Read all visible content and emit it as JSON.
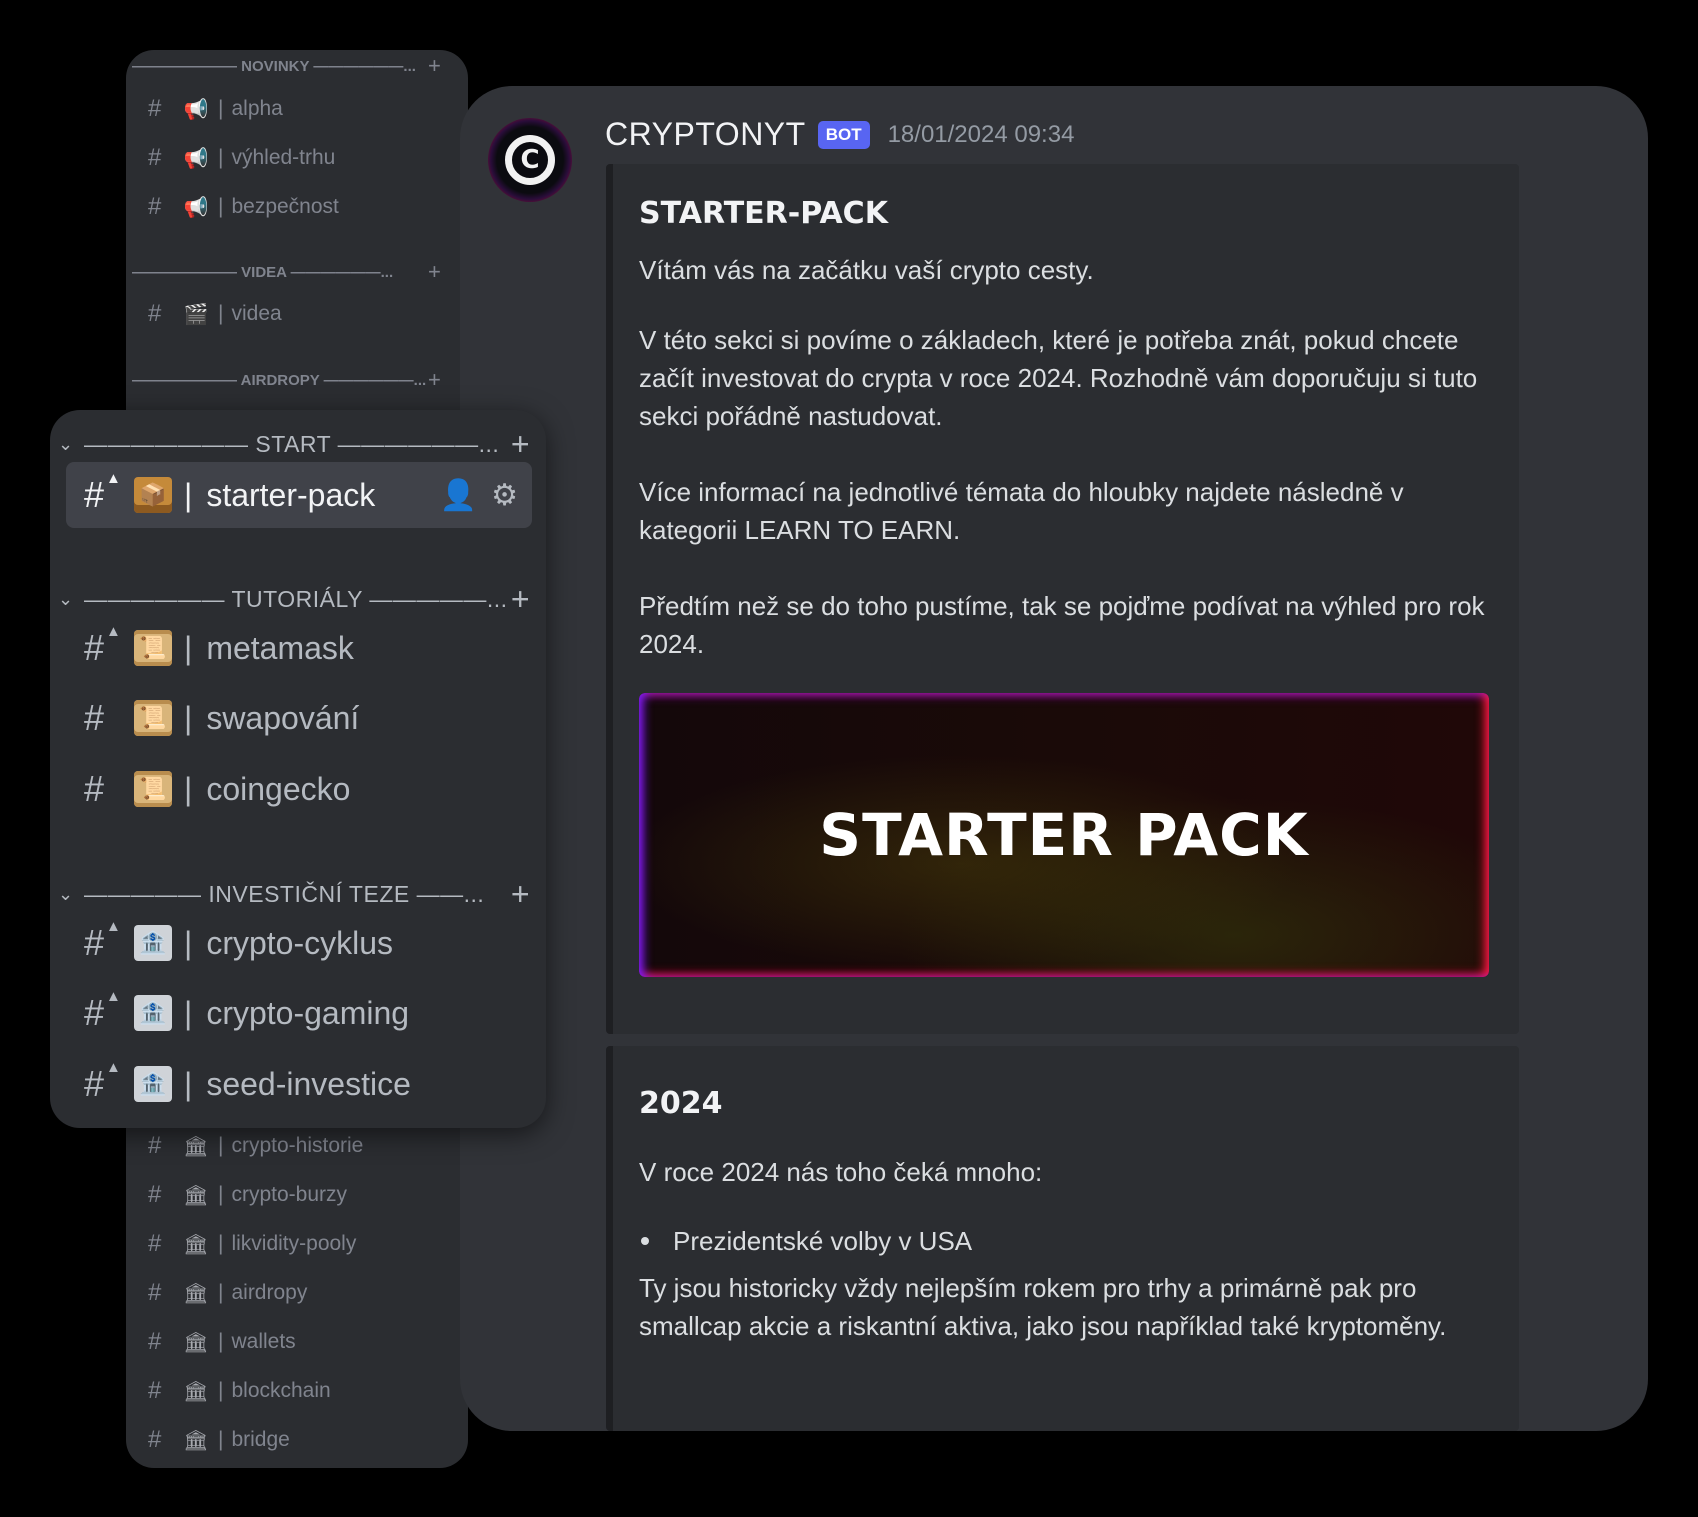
{
  "background_sidebar": {
    "categories": [
      {
        "label": "——————— NOVINKY ——————...",
        "plus": "+"
      },
      {
        "label": "——————— VIDEA ——————...",
        "plus": "+"
      },
      {
        "label": "——————— AIRDROPY ——————...",
        "plus": "+"
      }
    ],
    "channels": [
      {
        "hash": "#",
        "icon": "📢",
        "sep": "|",
        "name": "alpha"
      },
      {
        "hash": "#",
        "icon": "📢",
        "sep": "|",
        "name": "výhled-trhu"
      },
      {
        "hash": "#",
        "icon": "📢",
        "sep": "|",
        "name": "bezpečnost"
      },
      {
        "hash": "#",
        "icon": "🎬",
        "sep": "|",
        "name": "videa"
      },
      {
        "hash": "#",
        "icon": "🏛",
        "sep": "|",
        "name": "crypto-historie"
      },
      {
        "hash": "#",
        "icon": "🏛",
        "sep": "|",
        "name": "crypto-burzy"
      },
      {
        "hash": "#",
        "icon": "🏛",
        "sep": "|",
        "name": "likvidity-pooly"
      },
      {
        "hash": "#",
        "icon": "🏛",
        "sep": "|",
        "name": "airdropy"
      },
      {
        "hash": "#",
        "icon": "🏛",
        "sep": "|",
        "name": "wallets"
      },
      {
        "hash": "#",
        "icon": "🏛",
        "sep": "|",
        "name": "blockchain"
      },
      {
        "hash": "#",
        "icon": "🏛",
        "sep": "|",
        "name": "bridge"
      }
    ]
  },
  "sidebar": {
    "categories": [
      {
        "label": "——————— START ——————...",
        "chevron": "⌄",
        "plus": "+"
      },
      {
        "label": "—————— TUTORIÁLY —————...",
        "chevron": "⌄",
        "plus": "+"
      },
      {
        "label": "————— INVESTIČNÍ TEZE ——...",
        "chevron": "⌄",
        "plus": "+"
      }
    ],
    "channels": [
      {
        "hash": "#",
        "icon": "📦",
        "sep": "|",
        "name": "starter-pack",
        "active": true
      },
      {
        "hash": "#",
        "icon": "📜",
        "sep": "|",
        "name": "metamask"
      },
      {
        "hash": "#",
        "icon": "📜",
        "sep": "|",
        "name": "swapování"
      },
      {
        "hash": "#",
        "icon": "📜",
        "sep": "|",
        "name": "coingecko"
      },
      {
        "hash": "#",
        "icon": "🏦",
        "sep": "|",
        "name": "crypto-cyklus"
      },
      {
        "hash": "#",
        "icon": "🏦",
        "sep": "|",
        "name": "crypto-gaming"
      },
      {
        "hash": "#",
        "icon": "🏦",
        "sep": "|",
        "name": "seed-investice"
      }
    ],
    "active_actions": {
      "invite_icon": "add-member-icon",
      "settings_icon": "gear-icon",
      "invite_glyph": "👤",
      "settings_glyph": "⚙"
    }
  },
  "message": {
    "avatar_letter": "C",
    "author": "CRYPTONYT",
    "badge": "BOT",
    "timestamp": "18/01/2024 09:34",
    "embeds": [
      {
        "title": "STARTER-PACK",
        "paragraphs": [
          "Vítám vás na začátku vaší crypto cesty.",
          "V této sekci si povíme o základech, které je potřeba znát, pokud chcete začít investovat do crypta v roce 2024. Rozhodně vám doporučuju si tuto sekci pořádně nastudovat.",
          "Více informací na jednotlivé témata do hloubky najdete následně v kategorii LEARN TO EARN.",
          "Předtím než se do toho pustíme, tak se pojďme podívat na výhled pro rok 2024."
        ],
        "banner_text": "STARTER PACK"
      },
      {
        "title": "2024",
        "intro": "V roce 2024 nás toho čeká mnoho:",
        "bullets": [
          "Prezidentské volby v USA"
        ],
        "after_bullet": "Ty jsou historicky vždy nejlepším rokem pro trhy a primárně pak pro smallcap akcie a riskantní aktiva, jako jsou například také kryptoměny."
      }
    ]
  },
  "colors": {
    "page_bg": "#000000",
    "panel_bg": "#313338",
    "sidebar_bg": "#2b2d31",
    "active_channel_bg": "#404249",
    "bot_badge": "#5865f2",
    "banner_glow_left": "#7a1aff",
    "banner_glow_right": "#ff1a3a"
  }
}
